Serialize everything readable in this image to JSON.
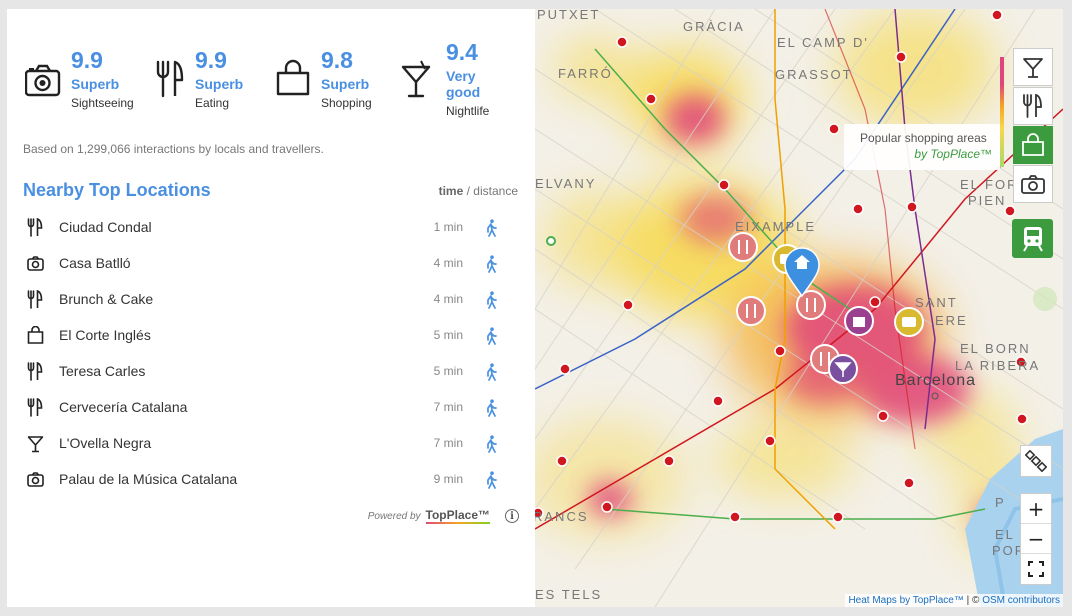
{
  "scores": [
    {
      "value": "9.9",
      "rating": "Superb",
      "category": "Sightseeing",
      "icon": "camera-icon"
    },
    {
      "value": "9.9",
      "rating": "Superb",
      "category": "Eating",
      "icon": "fork-knife-icon"
    },
    {
      "value": "9.8",
      "rating": "Superb",
      "category": "Shopping",
      "icon": "shopping-bag-icon"
    },
    {
      "value": "9.4",
      "rating": "Very good",
      "category": "Nightlife",
      "icon": "cocktail-icon"
    }
  ],
  "based_on": "Based on 1,299,066 interactions by locals and travellers.",
  "nearby": {
    "title": "Nearby Top Locations",
    "time_label": "time",
    "distance_label": "/ distance",
    "items": [
      {
        "name": "Ciudad Condal",
        "time": "1 min",
        "icon": "fork-knife-icon"
      },
      {
        "name": "Casa Batlló",
        "time": "4 min",
        "icon": "camera-icon"
      },
      {
        "name": "Brunch & Cake",
        "time": "4 min",
        "icon": "fork-knife-icon"
      },
      {
        "name": "El Corte Inglés",
        "time": "5 min",
        "icon": "shopping-bag-icon"
      },
      {
        "name": "Teresa Carles",
        "time": "5 min",
        "icon": "fork-knife-icon"
      },
      {
        "name": "Cervecería Catalana",
        "time": "7 min",
        "icon": "fork-knife-icon"
      },
      {
        "name": "L'Ovella Negra",
        "time": "7 min",
        "icon": "cocktail-icon"
      },
      {
        "name": "Palau de la Música Catalana",
        "time": "9 min",
        "icon": "camera-icon"
      }
    ]
  },
  "powered": {
    "prefix": "Powered by",
    "brand": "TopPlace™",
    "info": "i"
  },
  "map": {
    "labels": {
      "putxet": "PUTXET",
      "gracia": "GRÀCIA",
      "el_camp_1": "EL CAMP D'",
      "el_camp_2": "GRASSOT",
      "farro": "FARRÓ",
      "elvany": "ELVANY",
      "eixample": "EIXAMPLE",
      "sant_pere_1": "SANT",
      "sant_pere_2": "ERE",
      "el_fort_1": "EL FOR",
      "el_fort_2": "PIEN",
      "el_born_1": "EL BORN",
      "el_born_2": "LA RIBERA",
      "barcelona": "Barcelona",
      "francs": "RANCS",
      "pot_1": "P",
      "pot_2": "EL",
      "pot_3": "POR",
      "bottom": "ES TELS"
    },
    "tooltip": {
      "title": "Popular shopping areas",
      "by": "by TopPlace™"
    },
    "zoom": {
      "plus": "+",
      "minus": "−"
    },
    "attribution": {
      "heatmaps": "Heat Maps by TopPlace™",
      "sep": " | © ",
      "osm": "OSM contributors"
    },
    "colors": {
      "accent": "#4a90e2",
      "active_green": "#3c9b3f",
      "metro_red": "#d0161f",
      "heat_pink": "#e0457b"
    }
  }
}
